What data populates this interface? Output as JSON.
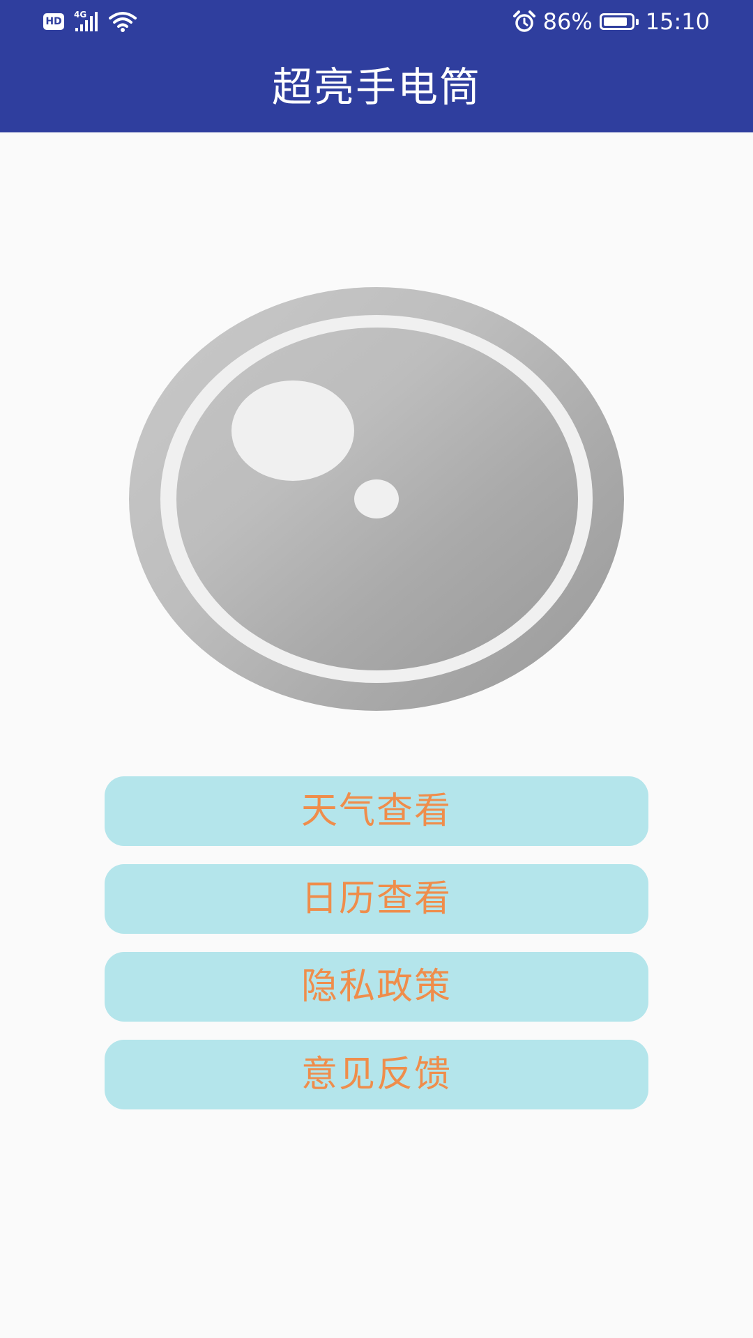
{
  "status_bar": {
    "hd_label": "HD",
    "network_label": "4G",
    "signal_icon": "cellular-signal-icon",
    "wifi_icon": "wifi-icon",
    "alarm_icon": "alarm-clock-icon",
    "battery_percent_label": "86%",
    "battery_level": 0.86,
    "time": "15:10"
  },
  "app_bar": {
    "title": "超亮手电筒",
    "background_color": "#2F3E9E"
  },
  "flashlight": {
    "icon": "flashlight-lens-toggle",
    "state": "off"
  },
  "menu": {
    "items": [
      {
        "label": "天气查看"
      },
      {
        "label": "日历查看"
      },
      {
        "label": "隐私政策"
      },
      {
        "label": "意见反馈"
      }
    ],
    "button_color": "#B4E5EB",
    "text_color": "#EF8D4B"
  }
}
